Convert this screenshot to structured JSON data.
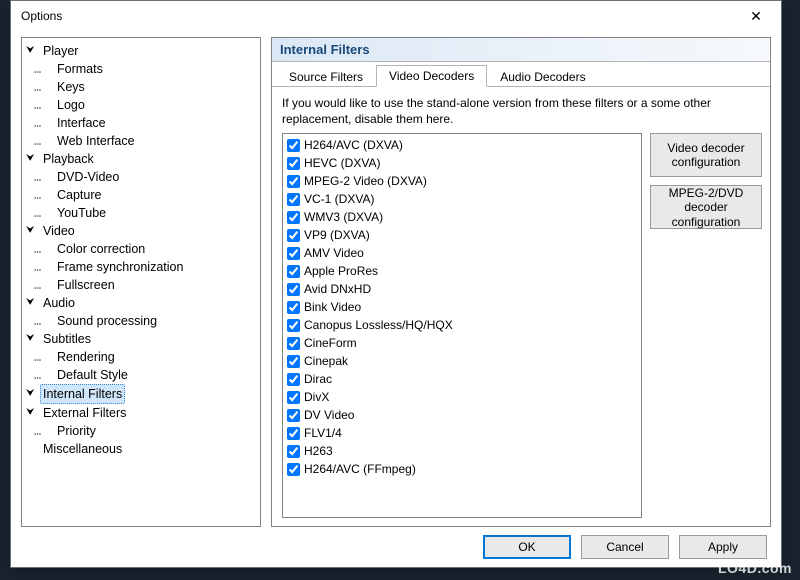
{
  "window": {
    "title": "Options"
  },
  "watermark": "LO4D.com",
  "tree": [
    {
      "label": "Player",
      "expanded": true,
      "children": [
        {
          "label": "Formats"
        },
        {
          "label": "Keys"
        },
        {
          "label": "Logo"
        },
        {
          "label": "Interface"
        },
        {
          "label": "Web Interface"
        }
      ]
    },
    {
      "label": "Playback",
      "expanded": true,
      "children": [
        {
          "label": "DVD-Video"
        },
        {
          "label": "Capture"
        },
        {
          "label": "YouTube"
        }
      ]
    },
    {
      "label": "Video",
      "expanded": true,
      "children": [
        {
          "label": "Color correction"
        },
        {
          "label": "Frame synchronization"
        },
        {
          "label": "Fullscreen"
        }
      ]
    },
    {
      "label": "Audio",
      "expanded": true,
      "children": [
        {
          "label": "Sound processing"
        }
      ]
    },
    {
      "label": "Subtitles",
      "expanded": true,
      "children": [
        {
          "label": "Rendering"
        },
        {
          "label": "Default Style"
        }
      ]
    },
    {
      "label": "Internal Filters",
      "expanded": true,
      "selected": true
    },
    {
      "label": "External Filters",
      "expanded": true,
      "children": [
        {
          "label": "Priority"
        }
      ]
    },
    {
      "label": "Miscellaneous"
    }
  ],
  "panel": {
    "title": "Internal Filters",
    "tabs": [
      {
        "label": "Source Filters",
        "active": false
      },
      {
        "label": "Video Decoders",
        "active": true
      },
      {
        "label": "Audio Decoders",
        "active": false
      }
    ],
    "hint": "If you would like to use the stand-alone version from these filters or a some other replacement, disable them here.",
    "filters": [
      {
        "label": "H264/AVC (DXVA)",
        "checked": true
      },
      {
        "label": "HEVC (DXVA)",
        "checked": true
      },
      {
        "label": "MPEG-2 Video (DXVA)",
        "checked": true
      },
      {
        "label": "VC-1 (DXVA)",
        "checked": true
      },
      {
        "label": "WMV3 (DXVA)",
        "checked": true
      },
      {
        "label": "VP9 (DXVA)",
        "checked": true
      },
      {
        "label": "AMV Video",
        "checked": true
      },
      {
        "label": "Apple ProRes",
        "checked": true
      },
      {
        "label": "Avid DNxHD",
        "checked": true
      },
      {
        "label": "Bink Video",
        "checked": true
      },
      {
        "label": "Canopus Lossless/HQ/HQX",
        "checked": true
      },
      {
        "label": "CineForm",
        "checked": true
      },
      {
        "label": "Cinepak",
        "checked": true
      },
      {
        "label": "Dirac",
        "checked": true
      },
      {
        "label": "DivX",
        "checked": true
      },
      {
        "label": "DV Video",
        "checked": true
      },
      {
        "label": "FLV1/4",
        "checked": true
      },
      {
        "label": "H263",
        "checked": true
      },
      {
        "label": "H264/AVC (FFmpeg)",
        "checked": true
      }
    ],
    "side_buttons": [
      "Video decoder configuration",
      "MPEG-2/DVD decoder configuration"
    ]
  },
  "footer": {
    "ok": "OK",
    "cancel": "Cancel",
    "apply": "Apply"
  }
}
